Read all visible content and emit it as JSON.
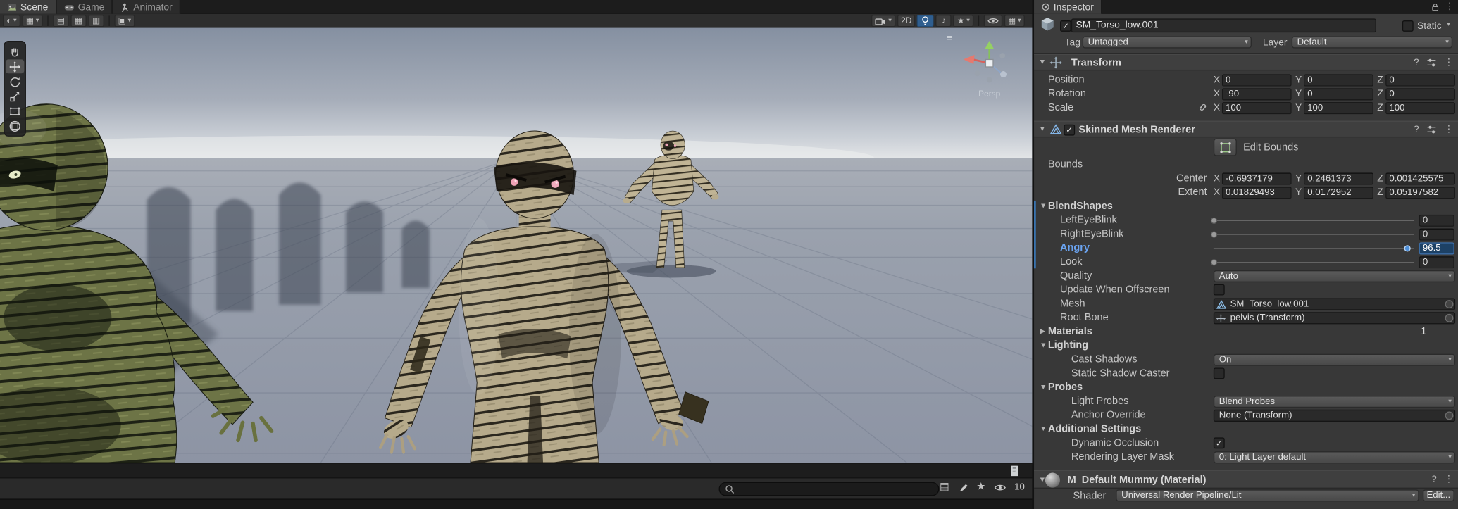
{
  "colors": {
    "accent": "#3a79bb",
    "selection_blue": "#1d4165",
    "sky_top": "#8792a3",
    "ground": "#99a0ac"
  },
  "tabs": {
    "scene": "Scene",
    "game": "Game",
    "animator": "Animator",
    "inspector": "Inspector"
  },
  "scene_toolbar": {
    "two_d": "2D"
  },
  "viewport": {
    "projection_label": "Persp"
  },
  "bottom_bar": {
    "search_placeholder": "",
    "hidden_count": "10"
  },
  "icons": {
    "caret": "▾",
    "kebab": "⋮",
    "help": "?",
    "check": "✓",
    "fold_open": "▼",
    "fold_closed": "▶",
    "menu": "≡",
    "note": "♪",
    "star": "★",
    "grid": "▦",
    "grid2": "▤",
    "grid3": "▥",
    "sphere": "◐",
    "square": "▣",
    "list": "▤"
  },
  "inspector": {
    "header": {
      "name": "SM_Torso_low.001",
      "active_checked": true,
      "static_checked": false,
      "static_label": "Static",
      "tag_label": "Tag",
      "tag_value": "Untagged",
      "layer_label": "Layer",
      "layer_value": "Default"
    },
    "transform": {
      "title": "Transform",
      "axis": [
        "X",
        "Y",
        "Z"
      ],
      "rows": [
        {
          "label": "Position",
          "values": [
            "0",
            "0",
            "0"
          ],
          "linked": false
        },
        {
          "label": "Rotation",
          "values": [
            "-90",
            "0",
            "0"
          ],
          "linked": false
        },
        {
          "label": "Scale",
          "values": [
            "100",
            "100",
            "100"
          ],
          "linked": true
        }
      ]
    },
    "skinned_mesh_renderer": {
      "title": "Skinned Mesh Renderer",
      "enabled_checked": true,
      "edit_bounds_label": "Edit Bounds",
      "bounds_label": "Bounds",
      "center": {
        "label": "Center",
        "values": [
          "-0.6937179",
          "0.2461373",
          "0.001425575"
        ]
      },
      "extent": {
        "label": "Extent",
        "values": [
          "0.01829493",
          "0.0172952",
          "0.05197582"
        ]
      },
      "blendshapes": {
        "title": "BlendShapes",
        "items": [
          {
            "label": "LeftEyeBlink",
            "value": "0",
            "pct": 0,
            "active": false
          },
          {
            "label": "RightEyeBlink",
            "value": "0",
            "pct": 0,
            "active": false
          },
          {
            "label": "Angry",
            "value": "96.5",
            "pct": 96.5,
            "active": true
          },
          {
            "label": "Look",
            "value": "0",
            "pct": 0,
            "active": false
          }
        ]
      },
      "quality_label": "Quality",
      "quality_value": "Auto",
      "update_when_offscreen_label": "Update When Offscreen",
      "update_when_offscreen_checked": false,
      "mesh_label": "Mesh",
      "mesh_value": "SM_Torso_low.001",
      "root_bone_label": "Root Bone",
      "root_bone_value": "pelvis (Transform)",
      "materials_label": "Materials",
      "materials_count": "1",
      "lighting_title": "Lighting",
      "cast_shadows_label": "Cast Shadows",
      "cast_shadows_value": "On",
      "static_shadow_caster_label": "Static Shadow Caster",
      "static_shadow_caster_checked": false,
      "probes_title": "Probes",
      "light_probes_label": "Light Probes",
      "light_probes_value": "Blend Probes",
      "anchor_override_label": "Anchor Override",
      "anchor_override_value": "None (Transform)",
      "additional_title": "Additional Settings",
      "dynamic_occlusion_label": "Dynamic Occlusion",
      "dynamic_occlusion_checked": true,
      "rendering_layer_mask_label": "Rendering Layer Mask",
      "rendering_layer_mask_value": "0: Light Layer default"
    },
    "material": {
      "title": "M_Default Mummy (Material)",
      "shader_label": "Shader",
      "shader_value": "Universal Render Pipeline/Lit",
      "edit_button": "Edit..."
    }
  }
}
